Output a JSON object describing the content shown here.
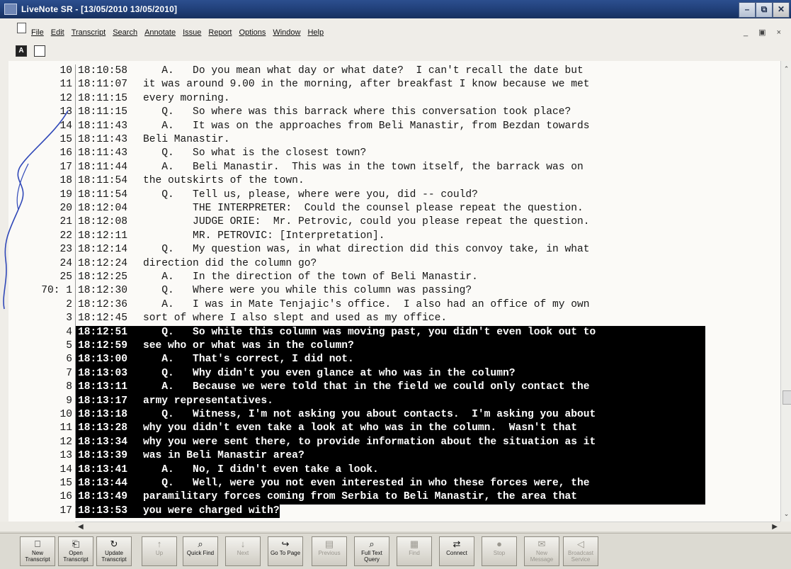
{
  "window": {
    "title": "LiveNote SR - [13/05/2010  13/05/2010]"
  },
  "menu": [
    "File",
    "Edit",
    "Transcript",
    "Search",
    "Annotate",
    "Issue",
    "Report",
    "Options",
    "Window",
    "Help"
  ],
  "transcript": {
    "lines": [
      {
        "ln": "10",
        "time": "18:10:58",
        "text": "   A.   Do you mean what day or what date?  I can't recall the date but",
        "sel": false
      },
      {
        "ln": "11",
        "time": "18:11:07",
        "text": "it was around 9.00 in the morning, after breakfast I know because we met",
        "sel": false
      },
      {
        "ln": "12",
        "time": "18:11:15",
        "text": "every morning.",
        "sel": false
      },
      {
        "ln": "13",
        "time": "18:11:15",
        "text": "   Q.   So where was this barrack where this conversation took place?",
        "sel": false
      },
      {
        "ln": "14",
        "time": "18:11:43",
        "text": "   A.   It was on the approaches from Beli Manastir, from Bezdan towards",
        "sel": false
      },
      {
        "ln": "15",
        "time": "18:11:43",
        "text": "Beli Manastir.",
        "sel": false
      },
      {
        "ln": "16",
        "time": "18:11:43",
        "text": "   Q.   So what is the closest town?",
        "sel": false
      },
      {
        "ln": "17",
        "time": "18:11:44",
        "text": "   A.   Beli Manastir.  This was in the town itself, the barrack was on",
        "sel": false
      },
      {
        "ln": "18",
        "time": "18:11:54",
        "text": "the outskirts of the town.",
        "sel": false
      },
      {
        "ln": "19",
        "time": "18:11:54",
        "text": "   Q.   Tell us, please, where were you, did -- could?",
        "sel": false
      },
      {
        "ln": "20",
        "time": "18:12:04",
        "text": "        THE INTERPRETER:  Could the counsel please repeat the question.",
        "sel": false
      },
      {
        "ln": "21",
        "time": "18:12:08",
        "text": "        JUDGE ORIE:  Mr. Petrovic, could you please repeat the question.",
        "sel": false
      },
      {
        "ln": "22",
        "time": "18:12:11",
        "text": "        MR. PETROVIC: [Interpretation].",
        "sel": false
      },
      {
        "ln": "23",
        "time": "18:12:14",
        "text": "   Q.   My question was, in what direction did this convoy take, in what",
        "sel": false
      },
      {
        "ln": "24",
        "time": "18:12:24",
        "text": "direction did the column go?",
        "sel": false
      },
      {
        "ln": "25",
        "time": "18:12:25",
        "text": "   A.   In the direction of the town of Beli Manastir.",
        "sel": false
      },
      {
        "ln": "70: 1",
        "time": "18:12:30",
        "text": "   Q.   Where were you while this column was passing?",
        "sel": false
      },
      {
        "ln": "2",
        "time": "18:12:36",
        "text": "   A.   I was in Mate Tenjajic's office.  I also had an office of my own",
        "sel": false
      },
      {
        "ln": "3",
        "time": "18:12:45",
        "text": "sort of where I also slept and used as my office.",
        "sel": false
      },
      {
        "ln": "4",
        "time": "18:12:51",
        "text": "   Q.   So while this column was moving past, you didn't even look out to",
        "sel": true
      },
      {
        "ln": "5",
        "time": "18:12:59",
        "text": "see who or what was in the column?",
        "sel": true
      },
      {
        "ln": "6",
        "time": "18:13:00",
        "text": "   A.   That's correct, I did not.",
        "sel": true
      },
      {
        "ln": "7",
        "time": "18:13:03",
        "text": "   Q.   Why didn't you even glance at who was in the column?",
        "sel": true
      },
      {
        "ln": "8",
        "time": "18:13:11",
        "text": "   A.   Because we were told that in the field we could only contact the",
        "sel": true
      },
      {
        "ln": "9",
        "time": "18:13:17",
        "text": "army representatives.",
        "sel": true
      },
      {
        "ln": "10",
        "time": "18:13:18",
        "text": "   Q.   Witness, I'm not asking you about contacts.  I'm asking you about",
        "sel": true
      },
      {
        "ln": "11",
        "time": "18:13:28",
        "text": "why you didn't even take a look at who was in the column.  Wasn't that",
        "sel": true
      },
      {
        "ln": "12",
        "time": "18:13:34",
        "text": "why you were sent there, to provide information about the situation as it",
        "sel": true
      },
      {
        "ln": "13",
        "time": "18:13:39",
        "text": "was in Beli Manastir area?",
        "sel": true
      },
      {
        "ln": "14",
        "time": "18:13:41",
        "text": "   A.   No, I didn't even take a look.",
        "sel": true
      },
      {
        "ln": "15",
        "time": "18:13:44",
        "text": "   Q.   Well, were you not even interested in who these forces were, the",
        "sel": true
      },
      {
        "ln": "16",
        "time": "18:13:49",
        "text": "paramilitary forces coming from Serbia to Beli Manastir, the area that",
        "sel": true
      },
      {
        "ln": "17",
        "time": "18:13:53",
        "text": "you were charged with?",
        "sel": true
      }
    ]
  },
  "toolbar": {
    "buttons": [
      {
        "label": "New Transcript",
        "icon": "new-transcript-icon",
        "glyph": "⎕",
        "disabled": false
      },
      {
        "label": "Open Transcript",
        "icon": "open-transcript-icon",
        "glyph": "⎗",
        "disabled": false
      },
      {
        "label": "Update Transcript",
        "icon": "update-transcript-icon",
        "glyph": "↻",
        "disabled": false
      },
      {
        "label": "Up",
        "icon": "arrow-up-icon",
        "glyph": "↑",
        "disabled": true
      },
      {
        "label": "Quick Find",
        "icon": "quick-find-icon",
        "glyph": "⌕",
        "disabled": false
      },
      {
        "label": "Next",
        "icon": "next-icon",
        "glyph": "↓",
        "disabled": true
      },
      {
        "label": "Go To Page",
        "icon": "go-to-page-icon",
        "glyph": "↪",
        "disabled": false
      },
      {
        "label": "Previous",
        "icon": "previous-icon",
        "glyph": "▤",
        "disabled": true
      },
      {
        "label": "Full Text Query",
        "icon": "full-text-query-icon",
        "glyph": "⌕",
        "disabled": false
      },
      {
        "label": "Find",
        "icon": "find-icon",
        "glyph": "▦",
        "disabled": true
      },
      {
        "label": "Connect",
        "icon": "connect-icon",
        "glyph": "⇄",
        "disabled": false
      },
      {
        "label": "Stop",
        "icon": "stop-icon",
        "glyph": "●",
        "disabled": true
      },
      {
        "label": "New Message",
        "icon": "new-message-icon",
        "glyph": "✉",
        "disabled": true
      },
      {
        "label": "Broadcast Service",
        "icon": "broadcast-icon",
        "glyph": "◁",
        "disabled": true
      }
    ]
  },
  "colors": {
    "selection_bg": "#000000",
    "selection_text": "#ffffff",
    "titlebar": "#1f3d75"
  }
}
